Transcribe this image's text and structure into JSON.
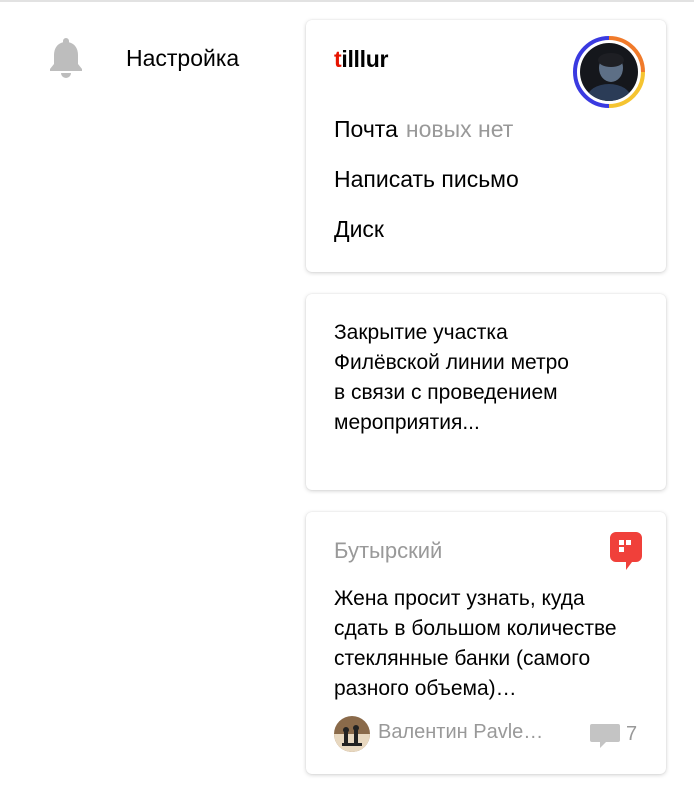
{
  "header": {
    "bell_icon": "bell-icon",
    "settings_label": "Настройка"
  },
  "account": {
    "username_first": "t",
    "username_rest": "illlur",
    "username_first_color": "#e61400",
    "menu": [
      {
        "label": "Почта",
        "sub": "новых нет"
      },
      {
        "label": "Написать письмо",
        "sub": ""
      },
      {
        "label": "Диск",
        "sub": ""
      }
    ]
  },
  "news": {
    "text": "Закрытие участка Филёвской линии метро в связи с проведением мероприятия..."
  },
  "post": {
    "district": "Бутырский",
    "text": "Жена просит узнать, куда сдать в большом количе­стве стеклянные банки (самого разного объема)…",
    "author": "Валентин Pavle…",
    "comments_count": "7",
    "badge_color": "#f0403a"
  }
}
